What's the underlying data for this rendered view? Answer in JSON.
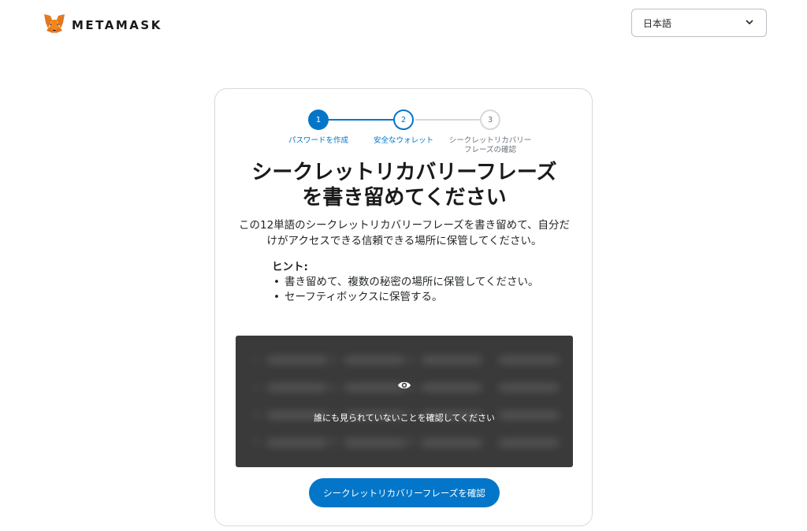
{
  "header": {
    "logo_text": "METAMASK",
    "language": {
      "selected": "日本語"
    }
  },
  "stepper": {
    "steps": [
      {
        "number": "1",
        "label": "パスワードを作成",
        "state": "complete"
      },
      {
        "number": "2",
        "label": "安全なウォレット",
        "state": "active"
      },
      {
        "number": "3",
        "label": "シークレットリカバリーフレーズの確認",
        "state": "inactive"
      }
    ]
  },
  "main": {
    "title": "シークレットリカバリーフレーズを書き留めてください",
    "description": "この12単語のシークレットリカバリーフレーズを書き留めて、自分だけがアクセスできる信頼できる場所に保管してください。",
    "hint": {
      "title": "ヒント:",
      "items": [
        "書き留めて、複数の秘密の場所に保管してください。",
        "セーフティボックスに保管する。"
      ]
    },
    "srp": {
      "reveal_text": "誰にも見られていないことを確認してください"
    },
    "confirm_button": "シークレットリカバリーフレーズを確認"
  },
  "colors": {
    "primary": "#0376c9",
    "srp_background": "#3a3a3a",
    "border": "#d6d9dc"
  },
  "icons": {
    "logo": "metamask-fox-icon",
    "dropdown": "chevron-down-icon",
    "reveal": "eye-icon"
  }
}
